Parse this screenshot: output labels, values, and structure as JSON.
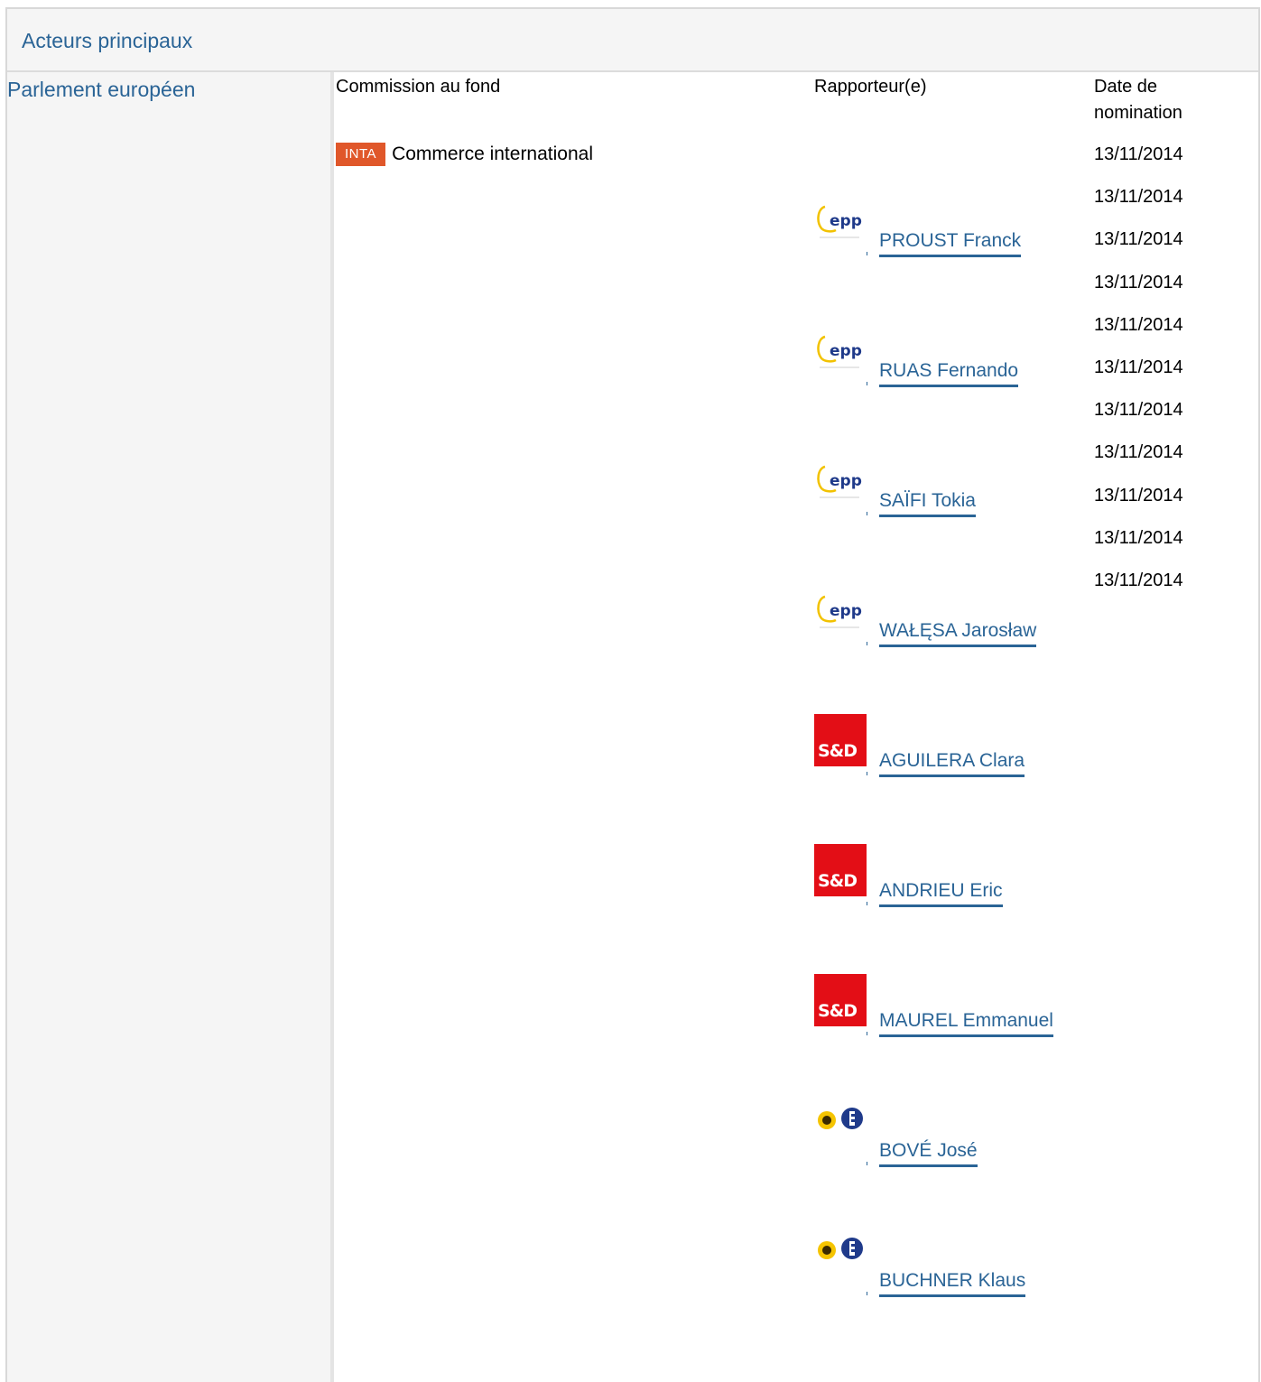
{
  "header": {
    "title": "Acteurs principaux"
  },
  "institution": {
    "name": "Parlement européen"
  },
  "columns": {
    "committee": "Commission au fond",
    "rapporteur": "Rapporteur(e)",
    "date": "Date de nomination"
  },
  "committee": {
    "code": "INTA",
    "name": "Commerce international",
    "color": "#e0572a"
  },
  "dates": [
    "13/11/2014",
    "13/11/2014",
    "13/11/2014",
    "13/11/2014",
    "13/11/2014",
    "13/11/2014",
    "13/11/2014",
    "13/11/2014",
    "13/11/2014",
    "13/11/2014",
    "13/11/2014"
  ],
  "rapporteurs": [
    {
      "name": "PROUST Franck",
      "group_icon": "epp-logo-icon"
    },
    {
      "name": "RUAS Fernando",
      "group_icon": "epp-logo-icon"
    },
    {
      "name": "SAÏFI Tokia",
      "group_icon": "epp-logo-icon"
    },
    {
      "name": "WAŁĘSA Jarosław",
      "group_icon": "epp-logo-icon"
    },
    {
      "name": "AGUILERA Clara",
      "group_icon": "sd-logo-icon",
      "group_label": "S&D"
    },
    {
      "name": "ANDRIEU Eric",
      "group_icon": "sd-logo-icon",
      "group_label": "S&D"
    },
    {
      "name": "MAUREL Emmanuel",
      "group_icon": "sd-logo-icon",
      "group_label": "S&D"
    },
    {
      "name": "BOVÉ José",
      "group_icon": "greens-efa-logo-icon"
    },
    {
      "name": "BUCHNER Klaus",
      "group_icon": "greens-efa-logo-icon"
    }
  ],
  "colors": {
    "link": "#2a6496",
    "sd_red": "#e30e16",
    "panel_bg": "#f5f5f5"
  }
}
